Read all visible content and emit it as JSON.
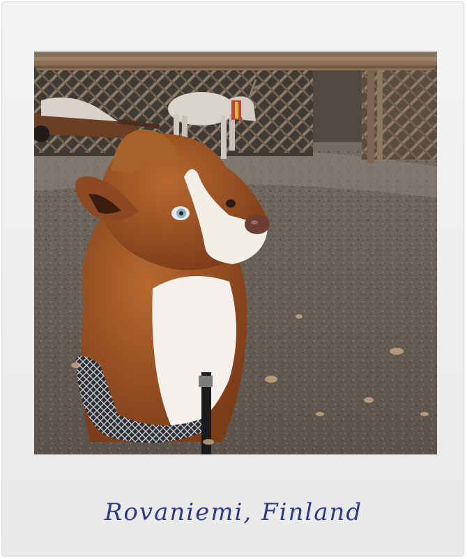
{
  "caption": {
    "text": "Rovaniemi, Finland",
    "color": "#2e3a86"
  },
  "photo": {
    "subjects": [
      "dog-icon",
      "reindeer-icon",
      "cart-icon",
      "fence-icon",
      "log-beam-icon"
    ],
    "palette": {
      "ground": "#6b625a",
      "dog_fur": "#9a4f22",
      "dog_chest": "#f4f1ec",
      "reindeer": "#d9d4cd",
      "fence": "#8a7766"
    }
  }
}
